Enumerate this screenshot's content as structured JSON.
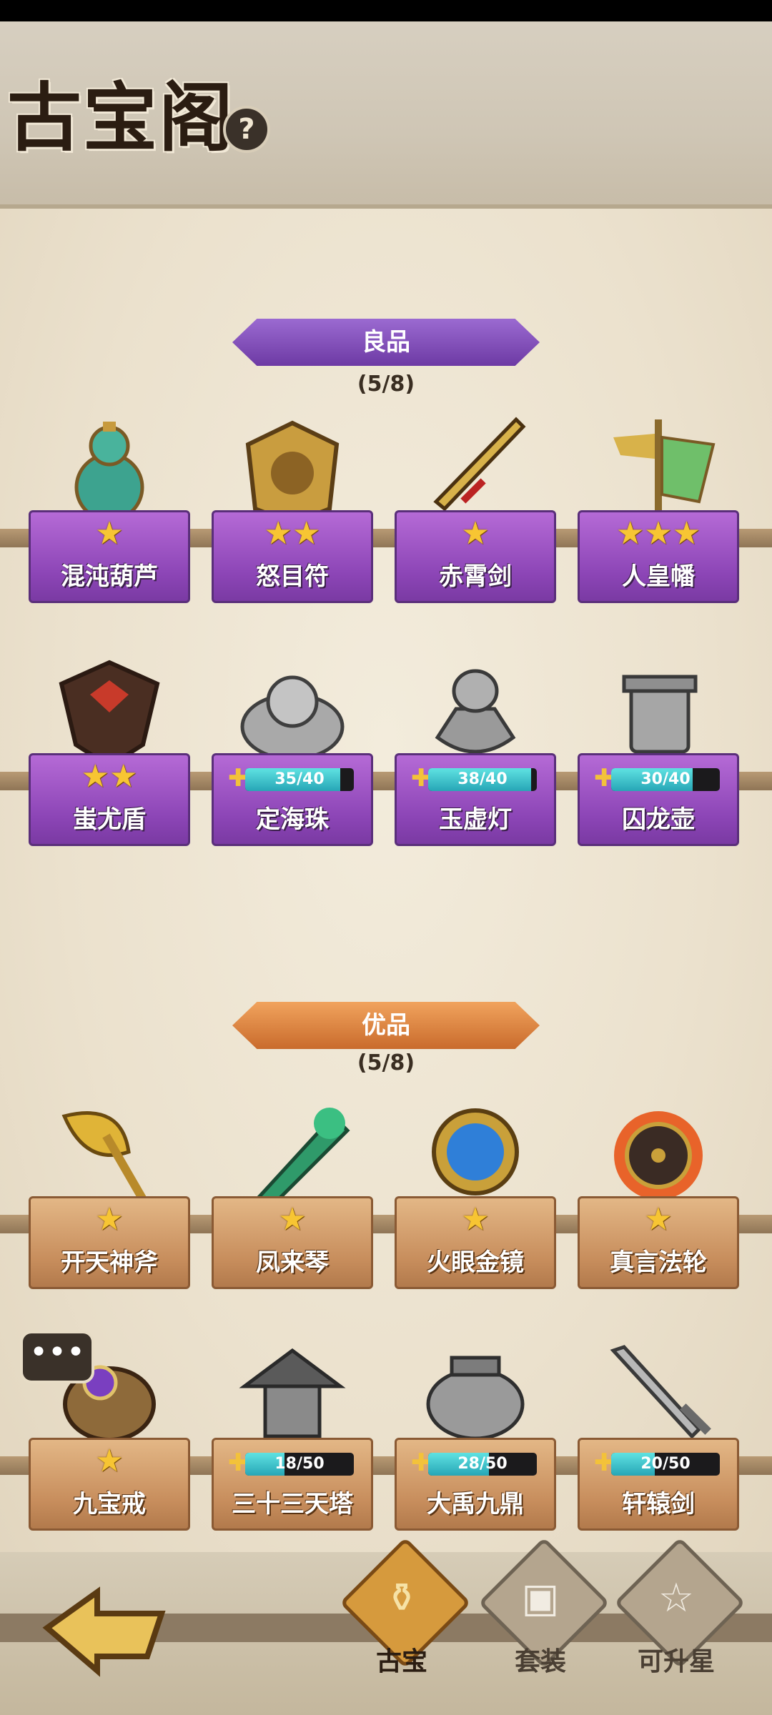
{
  "header": {
    "title": "古宝阁",
    "help_icon": "?"
  },
  "sections": [
    {
      "tier": "良品",
      "count": "(5/8)",
      "color": "#8c45b6",
      "items": [
        {
          "name": "混沌葫芦",
          "stars": "★",
          "icon": "gourd-icon"
        },
        {
          "name": "怒目符",
          "stars": "★★",
          "icon": "talisman-icon"
        },
        {
          "name": "赤霄剑",
          "stars": "★",
          "icon": "sword-icon"
        },
        {
          "name": "人皇幡",
          "stars": "★★★",
          "icon": "banner-icon"
        },
        {
          "name": "蚩尤盾",
          "stars": "★★",
          "icon": "shield-icon"
        },
        {
          "name": "定海珠",
          "progress_text": "35/40",
          "progress": 0.875,
          "icon": "dragon-pearl-icon"
        },
        {
          "name": "玉虚灯",
          "progress_text": "38/40",
          "progress": 0.95,
          "icon": "lamp-icon"
        },
        {
          "name": "囚龙壶",
          "progress_text": "30/40",
          "progress": 0.75,
          "icon": "vessel-icon"
        }
      ]
    },
    {
      "tier": "优品",
      "count": "(5/8)",
      "color": "#c78d5c",
      "items": [
        {
          "name": "开天神斧",
          "stars": "★",
          "icon": "axe-icon"
        },
        {
          "name": "凤来琴",
          "stars": "★",
          "icon": "zither-icon"
        },
        {
          "name": "火眼金镜",
          "stars": "★",
          "icon": "mirror-icon"
        },
        {
          "name": "真言法轮",
          "stars": "★",
          "icon": "wheel-icon"
        },
        {
          "name": "九宝戒",
          "stars": "★",
          "icon": "ring-icon"
        },
        {
          "name": "三十三天塔",
          "progress_text": "18/50",
          "progress": 0.36,
          "icon": "pagoda-icon"
        },
        {
          "name": "大禹九鼎",
          "progress_text": "28/50",
          "progress": 0.56,
          "icon": "cauldron-icon"
        },
        {
          "name": "轩辕剑",
          "progress_text": "20/50",
          "progress": 0.4,
          "icon": "greatsword-icon"
        }
      ]
    }
  ],
  "nav": [
    {
      "label": "古宝",
      "icon": "treasure-pot-icon",
      "active": true
    },
    {
      "label": "套装",
      "icon": "chest-icon",
      "active": false
    },
    {
      "label": "可升星",
      "icon": "star-up-icon",
      "active": false
    }
  ],
  "chat_bubble_icon": "chat-bubble-icon",
  "back_icon": "back-arrow-icon"
}
